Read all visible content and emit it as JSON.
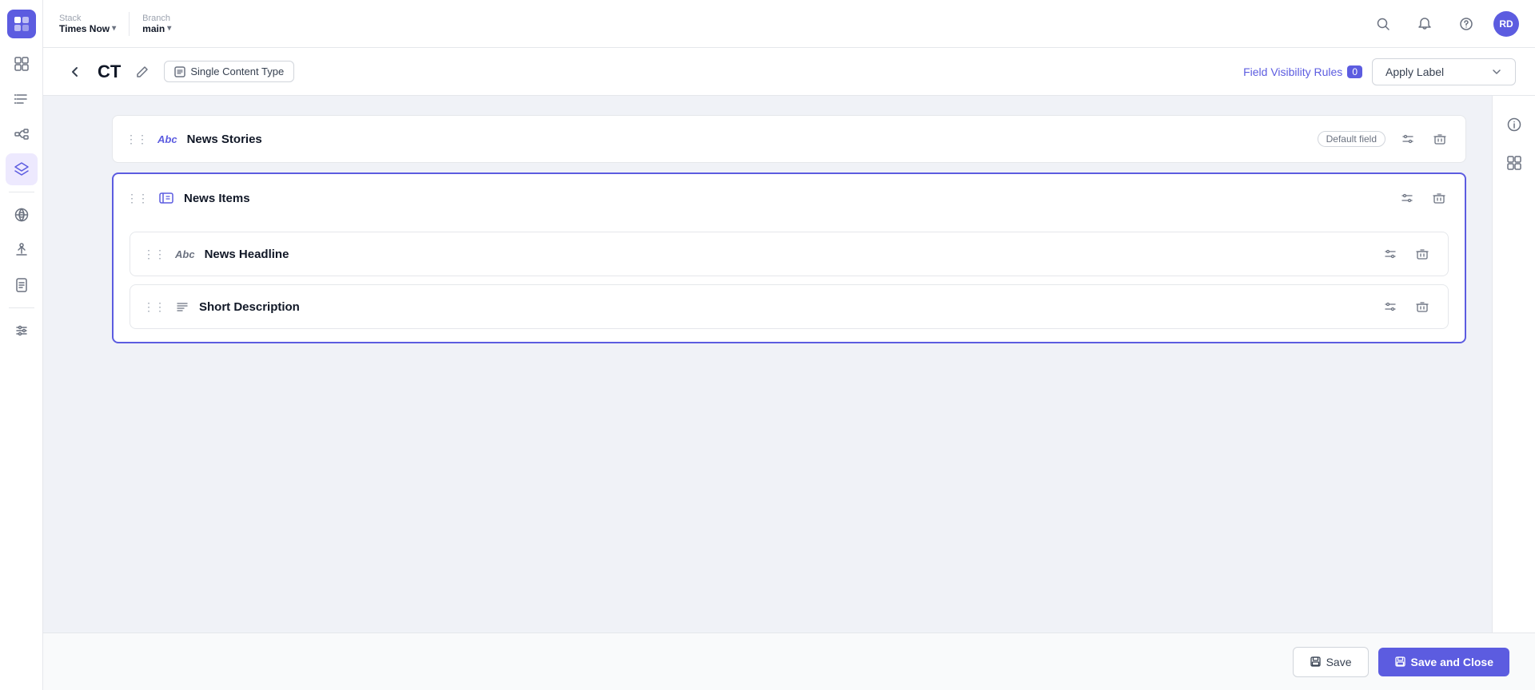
{
  "app": {
    "logo_icon": "stack-logo",
    "stack_label": "Stack",
    "stack_name": "Times Now",
    "branch_label": "Branch",
    "branch_name": "main"
  },
  "topbar": {
    "search_title": "Search",
    "notifications_title": "Notifications",
    "help_title": "Help",
    "avatar_text": "RD"
  },
  "content_header": {
    "back_label": "←",
    "ct_title": "CT",
    "edit_icon": "✎",
    "content_type_icon": "content-type-icon",
    "content_type_label": "Single Content Type",
    "visibility_rules_label": "Field Visibility Rules",
    "visibility_count": "0",
    "apply_label_text": "Apply Label",
    "chevron": "chevron-down"
  },
  "sidebar": {
    "items": [
      {
        "icon": "dashboard-icon",
        "active": false
      },
      {
        "icon": "list-icon",
        "active": false
      },
      {
        "icon": "schema-icon",
        "active": false
      },
      {
        "icon": "layers-icon",
        "active": true
      },
      {
        "icon": "network-icon",
        "active": false
      },
      {
        "icon": "deploy-icon",
        "active": false
      },
      {
        "icon": "audit-icon",
        "active": false
      },
      {
        "icon": "settings-icon",
        "active": false
      }
    ]
  },
  "fields": [
    {
      "id": "news-stories",
      "drag_icon": "⋮⋮",
      "field_icon": "Abc",
      "name": "News Stories",
      "badge": "Default field",
      "is_group": false
    },
    {
      "id": "news-items",
      "drag_icon": "⋮⋮",
      "field_icon": "group-icon",
      "name": "News Items",
      "is_group": true,
      "children": [
        {
          "id": "news-headline",
          "drag_icon": "⋮⋮",
          "field_icon": "Abc",
          "name": "News Headline"
        },
        {
          "id": "short-description",
          "drag_icon": "⋮⋮",
          "field_icon": "text-icon",
          "name": "Short Description"
        }
      ]
    }
  ],
  "footer": {
    "save_label": "Save",
    "save_close_label": "Save and Close",
    "save_icon": "💾",
    "save_close_icon": "💾"
  },
  "right_panel": {
    "info_icon": "ℹ",
    "component_icon": "⊞"
  }
}
